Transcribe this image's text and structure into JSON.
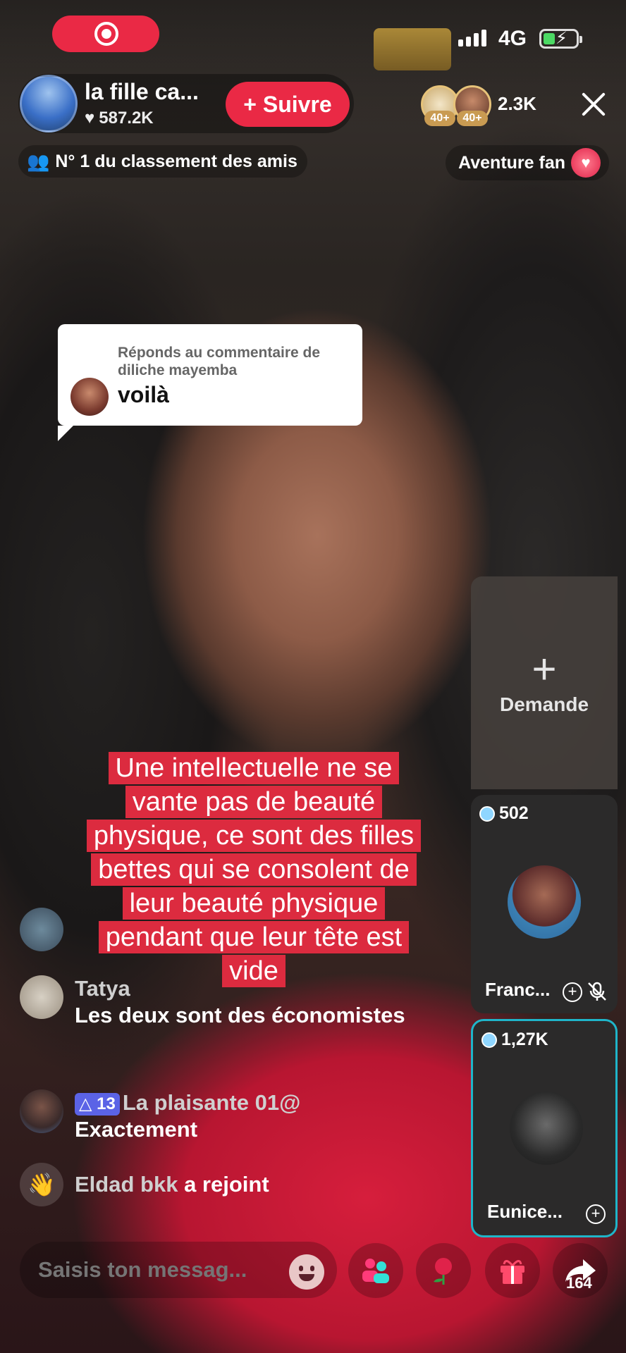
{
  "status": {
    "network": "4G"
  },
  "host": {
    "name": "la fille ca...",
    "likes": "587.2K",
    "follow_label": "+ Suivre"
  },
  "viewers": {
    "badges": [
      "40+",
      "40+"
    ],
    "count": "2.3K"
  },
  "rank": {
    "label": "N° 1 du classement des amis"
  },
  "adventure": {
    "label": "Aventure fan"
  },
  "reply": {
    "meta": "Réponds au commentaire de diliche mayemba",
    "text": "voilà"
  },
  "request": {
    "plus": "+",
    "label": "Demande"
  },
  "guests": [
    {
      "badge": "502",
      "name": "Franc..."
    },
    {
      "badge": "1,27K",
      "name": "Eunice..."
    }
  ],
  "caption": "Une intellectuelle ne se vante pas de beauté physique, ce sont des filles bettes qui se consolent de leur beauté physique pendant que leur tête est vide",
  "chat": [
    {
      "user": "Tatya",
      "msg": "Les deux sont des économistes"
    },
    {
      "level": "13",
      "user": "La plaisante 01@",
      "msg": "Exactement"
    },
    {
      "user": "Eldad bkk",
      "msg": "a rejoint"
    }
  ],
  "input": {
    "placeholder": "Saisis ton messag..."
  },
  "share_count": "164",
  "colors": {
    "accent": "#ea2945",
    "caption_bg": "#dc2b3f",
    "active_guest": "#1fb5c9"
  }
}
